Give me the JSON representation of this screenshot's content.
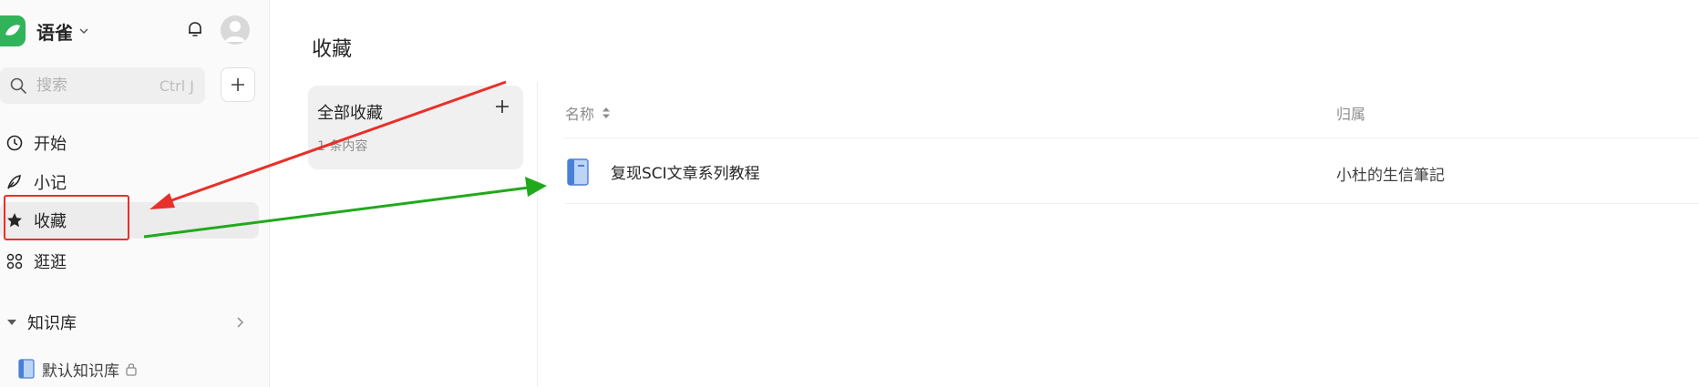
{
  "app": {
    "name": "语雀"
  },
  "header": {
    "bell_icon": "bell-icon",
    "avatar_icon": "user-avatar-icon"
  },
  "search": {
    "placeholder": "搜索",
    "shortcut": "Ctrl J"
  },
  "sidebar": {
    "nav": [
      {
        "label": "开始",
        "icon": "clock-icon"
      },
      {
        "label": "小记",
        "icon": "feather-icon"
      },
      {
        "label": "收藏",
        "icon": "star-icon",
        "active": true
      },
      {
        "label": "逛逛",
        "icon": "grid-dots-icon"
      }
    ],
    "knowledge_base": {
      "title": "知识库",
      "items": [
        {
          "label": "默认知识库",
          "icon": "book-icon",
          "locked": true
        }
      ]
    }
  },
  "main": {
    "title": "收藏",
    "collection": {
      "title": "全部收藏",
      "subtitle": "1 条内容"
    },
    "table": {
      "columns": [
        "名称",
        "归属"
      ],
      "rows": [
        {
          "name": "复现SCI文章系列教程",
          "owner": "小杜的生信筆記",
          "icon": "book-icon"
        }
      ]
    }
  },
  "colors": {
    "accent": "#31b35a",
    "annotation_red": "#e8302a",
    "annotation_green": "#21a91c"
  }
}
